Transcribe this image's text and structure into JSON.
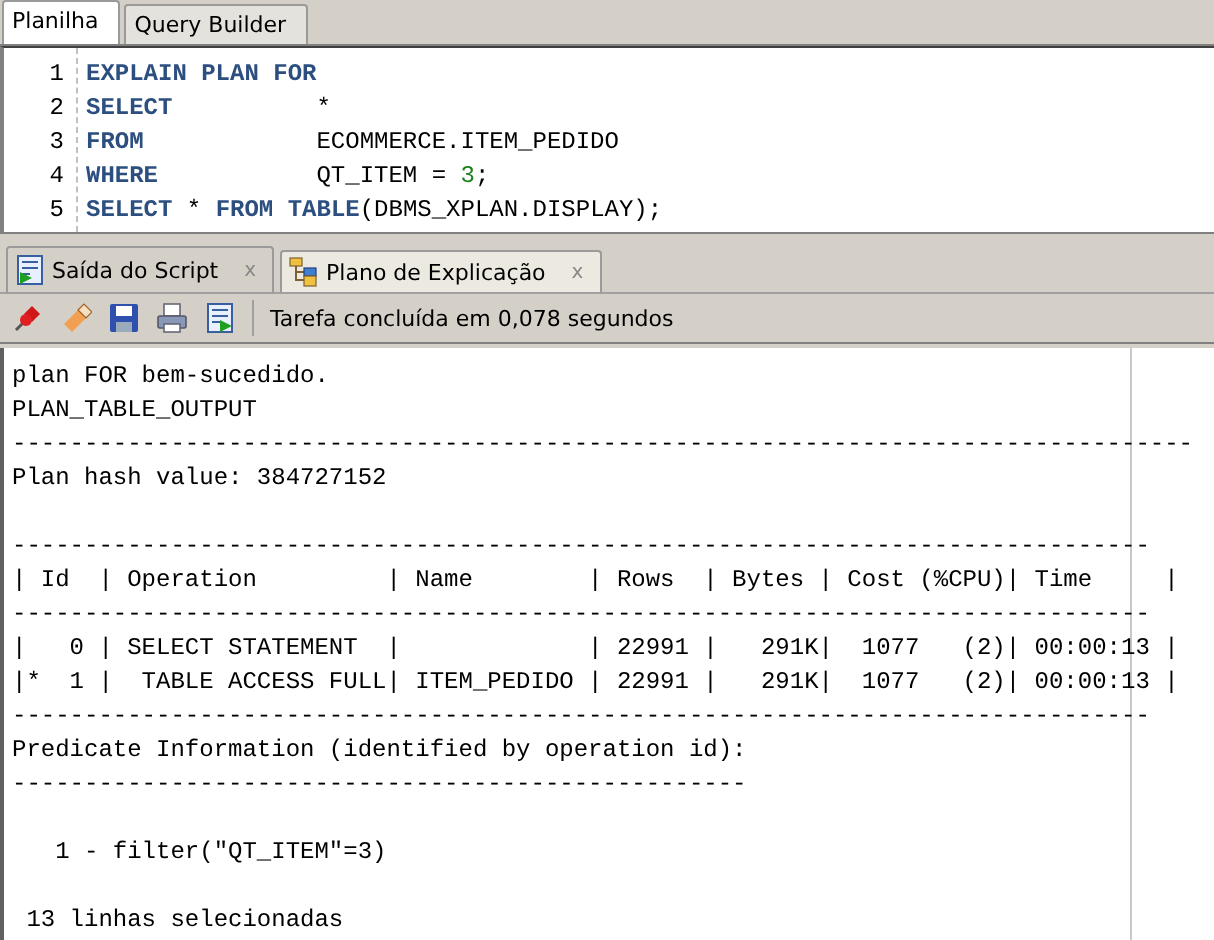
{
  "editor_tabs": [
    {
      "label": "Planilha",
      "selected": true
    },
    {
      "label": "Query Builder",
      "selected": false
    }
  ],
  "editor": {
    "lines": [
      {
        "number": "1",
        "tokens": [
          {
            "text": "EXPLAIN PLAN FOR",
            "kind": "keyword"
          }
        ]
      },
      {
        "number": "2",
        "tokens": [
          {
            "text": "SELECT",
            "kind": "keyword"
          },
          {
            "text": "          *",
            "kind": "plain"
          }
        ]
      },
      {
        "number": "3",
        "tokens": [
          {
            "text": "FROM",
            "kind": "keyword"
          },
          {
            "text": "            ECOMMERCE.ITEM_PEDIDO",
            "kind": "plain"
          }
        ]
      },
      {
        "number": "4",
        "tokens": [
          {
            "text": "WHERE",
            "kind": "keyword"
          },
          {
            "text": "           QT_ITEM = ",
            "kind": "plain"
          },
          {
            "text": "3",
            "kind": "number"
          },
          {
            "text": ";",
            "kind": "plain"
          }
        ]
      },
      {
        "number": "5",
        "tokens": [
          {
            "text": "SELECT",
            "kind": "keyword"
          },
          {
            "text": " * ",
            "kind": "plain"
          },
          {
            "text": "FROM TABLE",
            "kind": "keyword"
          },
          {
            "text": "(DBMS_XPLAN.DISPLAY);",
            "kind": "plain"
          }
        ]
      }
    ]
  },
  "output_tabs": [
    {
      "label": "Saída do Script",
      "close": "x",
      "selected": true
    },
    {
      "label": "Plano de Explicação",
      "close": "x",
      "selected": false
    }
  ],
  "toolbar": {
    "status": "Tarefa concluída em 0,078 segundos"
  },
  "output": [
    {
      "kind": "text",
      "text": "plan FOR bem-sucedido."
    },
    {
      "kind": "text",
      "text": "PLAN_TABLE_OUTPUT"
    },
    {
      "kind": "text",
      "text": "----------------------------------------------------------------------------------"
    },
    {
      "kind": "text",
      "text": "Plan hash value: 384727152"
    },
    {
      "kind": "blank"
    },
    {
      "kind": "text",
      "text": "-------------------------------------------------------------------------------"
    },
    {
      "kind": "text",
      "text": "| Id  | Operation         | Name        | Rows  | Bytes | Cost (%CPU)| Time     |"
    },
    {
      "kind": "text",
      "text": "-------------------------------------------------------------------------------"
    },
    {
      "kind": "text",
      "text": "|   0 | SELECT STATEMENT  |             | 22991 |   291K|  1077   (2)| 00:00:13 |"
    },
    {
      "kind": "text",
      "text": "|*  1 |  TABLE ACCESS FULL| ITEM_PEDIDO | 22991 |   291K|  1077   (2)| 00:00:13 |"
    },
    {
      "kind": "text",
      "text": "-------------------------------------------------------------------------------"
    },
    {
      "kind": "text",
      "text": "Predicate Information (identified by operation id):"
    },
    {
      "kind": "text",
      "text": "---------------------------------------------------"
    },
    {
      "kind": "blank"
    },
    {
      "kind": "text",
      "text": "   1 - filter(\"QT_ITEM\"=3)"
    },
    {
      "kind": "blank"
    },
    {
      "kind": "text",
      "text": " 13 linhas selecionadas"
    }
  ]
}
